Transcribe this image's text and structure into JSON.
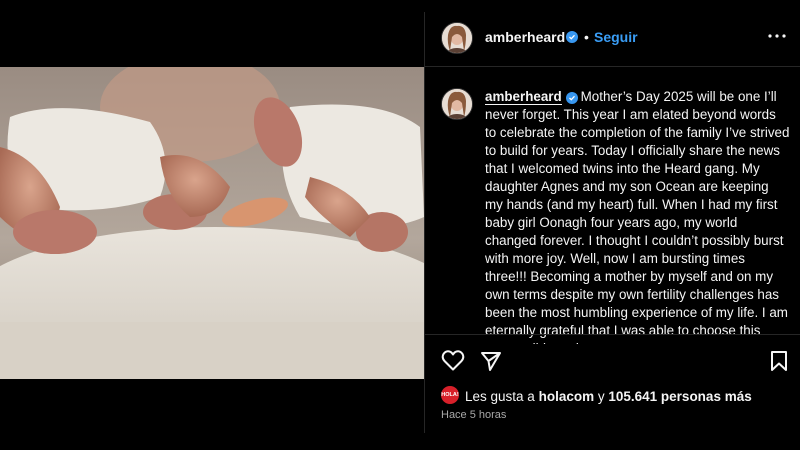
{
  "header": {
    "username": "amberheard",
    "separator": "•",
    "follow_label": "Seguir"
  },
  "post": {
    "caption_username": "amberheard",
    "caption_text": "Mother’s Day 2025 will be one I’ll never forget. This year I am elated beyond words to celebrate the completion of the family I’ve strived to build for years. Today I officially share the news that I welcomed twins into the Heard gang. My daughter Agnes and my son Ocean are keeping my hands (and my heart) full. When I had my first baby girl Oonagh four years ago, my world changed forever. I thought I couldn’t possibly burst with more joy. Well, now I am bursting times three!!! Becoming a mother by myself and on my own terms despite my own fertility challenges has been the most humbling experience of my life. I am eternally grateful that I was able to choose this responsibly and"
  },
  "likes": {
    "badge": "HOLA!",
    "prefix": "Les gusta a",
    "account": "holacom",
    "connector": "y",
    "count": "105.641 personas más"
  },
  "timestamp": "Hace 5 horas",
  "icons": {
    "verified": "verified-badge-icon",
    "more": "more-options-icon",
    "like": "heart-icon",
    "share": "send-icon",
    "save": "bookmark-icon"
  },
  "colors": {
    "background": "#000000",
    "follow": "#3a9df5",
    "verified": "#3897f0",
    "hola_badge": "#d8202a"
  }
}
